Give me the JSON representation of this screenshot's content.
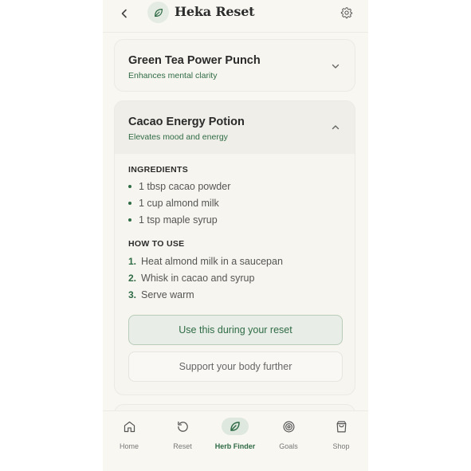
{
  "header": {
    "brand": "Heka Reset",
    "back_icon": "chevron-left-icon",
    "logo_icon": "leaf-icon",
    "settings_icon": "gear-icon"
  },
  "recipes": [
    {
      "title": "Green Tea Power Punch",
      "subtitle": "Enhances mental clarity",
      "expanded": false
    },
    {
      "title": "Cacao Energy Potion",
      "subtitle": "Elevates mood and energy",
      "expanded": true,
      "ingredients_label": "INGREDIENTS",
      "ingredients": [
        "1 tbsp cacao powder",
        "1 cup almond milk",
        "1 tsp maple syrup"
      ],
      "how_to_label": "HOW TO USE",
      "steps": [
        {
          "num": "1.",
          "text": "Heat almond milk in a saucepan"
        },
        {
          "num": "2.",
          "text": "Whisk in cacao and syrup"
        },
        {
          "num": "3.",
          "text": "Serve warm"
        }
      ],
      "primary_action": "Use this during your reset",
      "secondary_action": "Support your body further"
    }
  ],
  "nav": {
    "items": [
      {
        "label": "Home",
        "icon": "home-icon"
      },
      {
        "label": "Reset",
        "icon": "rotate-ccw-icon"
      },
      {
        "label": "Herb Finder",
        "icon": "leaf-icon",
        "active": true
      },
      {
        "label": "Goals",
        "icon": "target-icon"
      },
      {
        "label": "Shop",
        "icon": "shopping-bag-icon"
      }
    ]
  },
  "colors": {
    "accent": "#2f6b45",
    "background": "#f8f7f2",
    "active_pill": "#dfe8de"
  }
}
